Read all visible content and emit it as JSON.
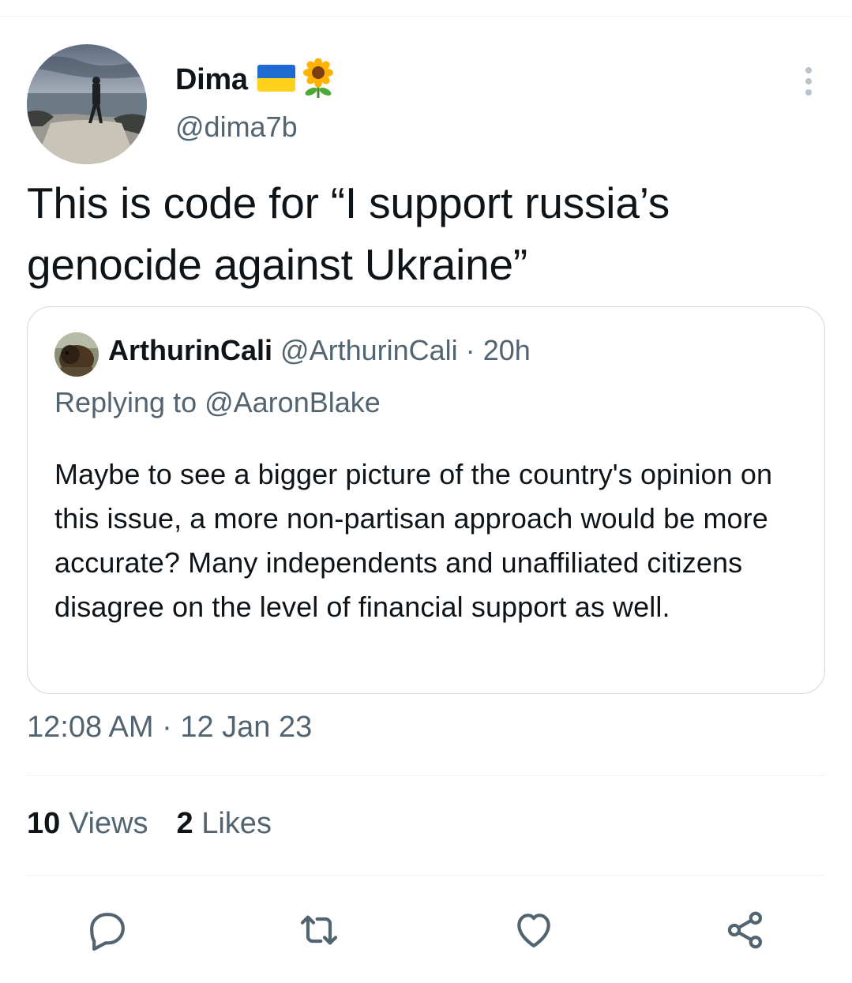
{
  "author": {
    "display_name": "Dima",
    "flag_emoji": "ukraine-flag-icon",
    "extra_emoji": "sunflower-icon",
    "handle": "@dima7b"
  },
  "tweet": {
    "text": "This is code for “I support russia’s genocide against Ukraine”",
    "timestamp": "12:08 AM · 12 Jan 23"
  },
  "quoted": {
    "display_name": "ArthurinCali",
    "handle": "@ArthurinCali",
    "dot": "·",
    "time": "20h",
    "replying_to": "Replying to @AaronBlake",
    "text": "Maybe to see a bigger picture of the country's opinion on this issue, a more non-partisan approach would be more accurate? Many independents and unaffiliated citizens disagree on the level of financial support as well."
  },
  "stats": {
    "views_count": "10",
    "views_label": "Views",
    "likes_count": "2",
    "likes_label": "Likes"
  },
  "actions": [
    "reply-icon",
    "retweet-icon",
    "like-icon",
    "share-icon"
  ],
  "colors": {
    "text_primary": "#0f1419",
    "text_secondary": "#536471",
    "border": "#cfd9de",
    "divider": "#eff3f4"
  }
}
